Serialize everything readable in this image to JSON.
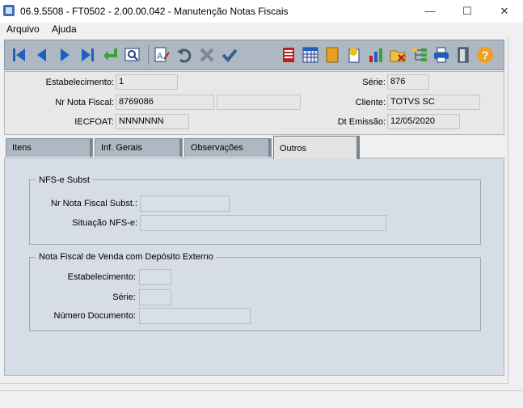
{
  "window": {
    "title": "06.9.5508 - FT0502 - 2.00.00.042 - Manutenção Notas Fiscais",
    "minimize_glyph": "—",
    "maximize_glyph": "☐",
    "close_glyph": "✕"
  },
  "menu": [
    {
      "label": "Arquivo"
    },
    {
      "label": "Ajuda"
    }
  ],
  "toolbar": {
    "buttons": [
      "first-record",
      "previous-record",
      "next-record",
      "last-record",
      "goto",
      "search",
      "edit",
      "undo",
      "cancel",
      "confirm",
      "list",
      "calendar",
      "book",
      "import",
      "report",
      "delete-filter",
      "tree",
      "print",
      "exit",
      "help"
    ]
  },
  "header": {
    "estabelecimento": {
      "label": "Estabelecimento:",
      "value": "1"
    },
    "nr_nota_fiscal": {
      "label": "Nr Nota Fiscal:",
      "value": "8769086",
      "value2": ""
    },
    "iecfoat": {
      "label": "IECFOAT:",
      "value": "NNNNNNN"
    },
    "serie": {
      "label": "Série:",
      "value": "876"
    },
    "cliente": {
      "label": "Cliente:",
      "value": "TOTVS SC"
    },
    "dt_emissao": {
      "label": "Dt Emissão:",
      "value": "12/05/2020"
    }
  },
  "tabs": [
    {
      "label": "Itens"
    },
    {
      "label": "Inf. Gerais"
    },
    {
      "label": "Observações"
    },
    {
      "label": "Outros",
      "active": true
    }
  ],
  "nfse_group": {
    "title": "NFS-e Subst",
    "nr_label": "Nr Nota Fiscal Subst.:",
    "nr_value": "",
    "situacao_label": "Situação NFS-e:",
    "situacao_value": ""
  },
  "venda_group": {
    "title": "Nota Fiscal de Venda com Depósito Externo",
    "estab_label": "Estabelecimento:",
    "estab_value": "",
    "serie_label": "Série:",
    "serie_value": "",
    "numero_label": "Número Documento:",
    "numero_value": ""
  },
  "colors": {
    "toolbar": "#aeb8c2",
    "tab_body": "#d6dde7",
    "accent_blue": "#1f5fbf",
    "accent_green": "#3aa03a",
    "help_orange": "#f0a020"
  }
}
